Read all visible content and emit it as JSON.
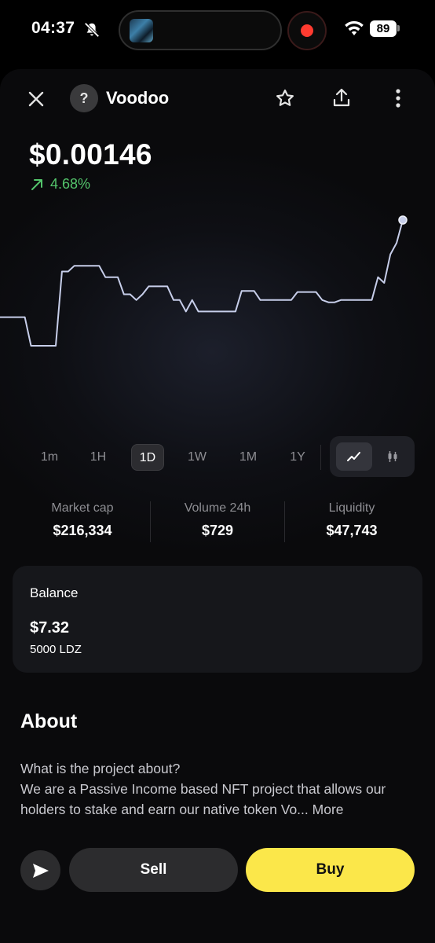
{
  "status_bar": {
    "time": "04:37",
    "battery": "89",
    "icons": [
      "bell-muted-icon",
      "wifi-icon",
      "battery-icon",
      "screen-record-icon"
    ]
  },
  "header": {
    "token_name": "Voodoo",
    "token_icon": "?",
    "icons": [
      "close-icon",
      "star-icon",
      "share-icon",
      "more-vertical-icon"
    ]
  },
  "price": {
    "value": "$0.00146",
    "change": "4.68%",
    "change_color": "#53c46b",
    "change_icon": "arrow-up-right-icon"
  },
  "chart_data": {
    "type": "line",
    "title": "",
    "line_color": "#c7ceea",
    "y": [
      0.001375,
      0.001375,
      0.001375,
      0.001375,
      0.001375,
      0.00135,
      0.00135,
      0.00135,
      0.00135,
      0.00135,
      0.001415,
      0.001415,
      0.00142,
      0.00142,
      0.00142,
      0.00142,
      0.00142,
      0.00141,
      0.00141,
      0.00141,
      0.001395,
      0.001395,
      0.00139,
      0.001395,
      0.001402,
      0.001402,
      0.001402,
      0.001402,
      0.00139,
      0.00139,
      0.00138,
      0.00139,
      0.00138,
      0.00138,
      0.00138,
      0.00138,
      0.00138,
      0.00138,
      0.00138,
      0.001398,
      0.001398,
      0.001398,
      0.00139,
      0.00139,
      0.00139,
      0.00139,
      0.00139,
      0.00139,
      0.001397,
      0.001397,
      0.001397,
      0.001397,
      0.00139,
      0.001388,
      0.001388,
      0.00139,
      0.00139,
      0.00139,
      0.00139,
      0.00139,
      0.00139,
      0.00141,
      0.001405,
      0.00143,
      0.00144,
      0.00146
    ]
  },
  "timeframes": {
    "items": [
      "1m",
      "1H",
      "1D",
      "1W",
      "1M",
      "1Y"
    ],
    "active": "1D",
    "chart_modes": [
      "line-chart-icon",
      "candlestick-icon"
    ]
  },
  "stats": {
    "market_cap_label": "Market cap",
    "market_cap_value": "$216,334",
    "volume_label": "Volume 24h",
    "volume_value": "$729",
    "liquidity_label": "Liquidity",
    "liquidity_value": "$47,743"
  },
  "balance": {
    "title": "Balance",
    "usd": "$7.32",
    "amount": "5000 LDZ"
  },
  "about": {
    "title": "About",
    "line1": "What is the project about?",
    "line2": "We are a Passive Income based NFT project that allows our holders to stake and earn our native token Vo...",
    "more": "More"
  },
  "actions": {
    "send_icon": "send-icon",
    "sell": "Sell",
    "buy": "Buy",
    "buy_color": "#fbe74a"
  }
}
